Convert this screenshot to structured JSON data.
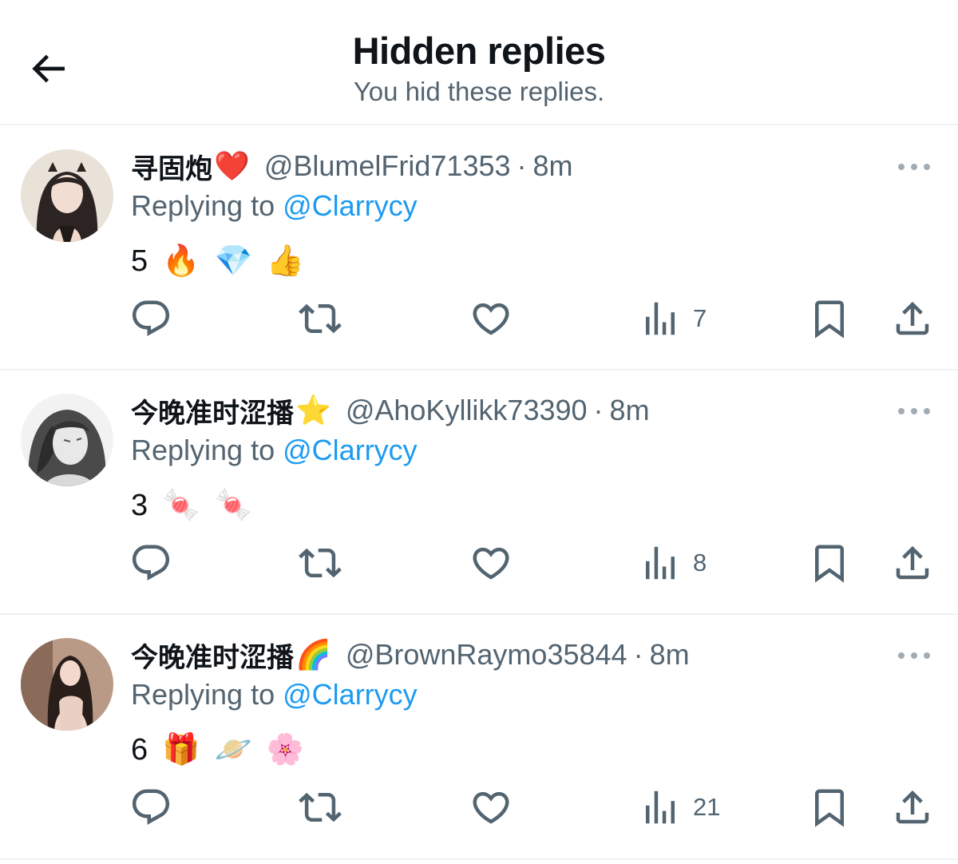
{
  "header": {
    "title": "Hidden replies",
    "subtitle": "You hid these replies."
  },
  "icons": {
    "back": "arrow-left-icon",
    "more": "more-horizontal-icon",
    "reply": "reply-icon",
    "retweet": "retweet-icon",
    "like": "heart-icon",
    "views": "views-chart-icon",
    "bookmark": "bookmark-icon",
    "share": "share-icon"
  },
  "colors": {
    "text_primary": "#0f1419",
    "text_secondary": "#536471",
    "link": "#1d9bf0",
    "divider": "#eff3f4"
  },
  "replies": [
    {
      "display_name": "寻固炮",
      "name_emoji": "❤️",
      "handle": "@BlumelFrid71353",
      "separator": "·",
      "time": "8m",
      "replying_prefix": "Replying to",
      "replying_to": "@Clarrycy",
      "body_number": "5",
      "body_emojis": [
        "🔥",
        "💎",
        "👍"
      ],
      "views": "7"
    },
    {
      "display_name": "今晚准时涩播",
      "name_emoji": "⭐",
      "handle": "@AhoKyllikk73390",
      "separator": "·",
      "time": "8m",
      "replying_prefix": "Replying to",
      "replying_to": "@Clarrycy",
      "body_number": "3",
      "body_emojis": [
        "🍬",
        "🍬"
      ],
      "views": "8"
    },
    {
      "display_name": "今晚准时涩播",
      "name_emoji": "🌈",
      "handle": "@BrownRaymo35844",
      "separator": "·",
      "time": "8m",
      "replying_prefix": "Replying to",
      "replying_to": "@Clarrycy",
      "body_number": "6",
      "body_emojis": [
        "🎁",
        "🪐",
        "🌸"
      ],
      "views": "21"
    }
  ]
}
